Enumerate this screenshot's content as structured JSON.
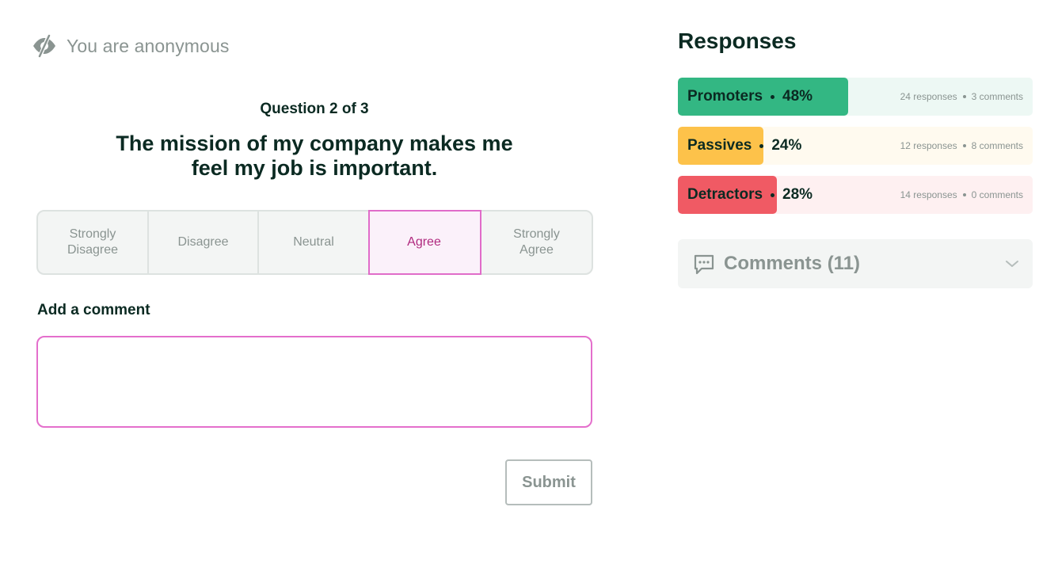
{
  "anonymous": {
    "text": "You are anonymous",
    "icon": "eye-off-icon"
  },
  "question": {
    "counter": "Question 2 of 3",
    "text": "The mission of my company makes me feel my job is important."
  },
  "options": [
    {
      "label": "Strongly Disagree",
      "selected": false
    },
    {
      "label": "Disagree",
      "selected": false
    },
    {
      "label": "Neutral",
      "selected": false
    },
    {
      "label": "Agree",
      "selected": true
    },
    {
      "label": "Strongly Agree",
      "selected": false
    }
  ],
  "comment": {
    "label": "Add a comment",
    "value": "",
    "placeholder": ""
  },
  "submit_label": "Submit",
  "responses": {
    "title": "Responses",
    "groups": [
      {
        "name": "Promoters",
        "percent": "48%",
        "share": 0.48,
        "responses": "24 responses",
        "comments": "3 comments",
        "color": "#33b783",
        "bg": "#edf8f4"
      },
      {
        "name": "Passives",
        "percent": "24%",
        "share": 0.24,
        "responses": "12 responses",
        "comments": "8 comments",
        "color": "#fdc24a",
        "bg": "#fffaef"
      },
      {
        "name": "Detractors",
        "percent": "28%",
        "share": 0.28,
        "responses": "14 responses",
        "comments": "0 comments",
        "color": "#f05a64",
        "bg": "#fef0f1"
      }
    ]
  },
  "comments_panel": {
    "label": "Comments (11)",
    "icon": "chat-bubble-icon",
    "toggle_icon": "chevron-down-icon"
  },
  "colors": {
    "accent": "#e46fcc",
    "selected_text": "#b02a7f",
    "text": "#0b2a22",
    "muted": "#8a9491"
  }
}
